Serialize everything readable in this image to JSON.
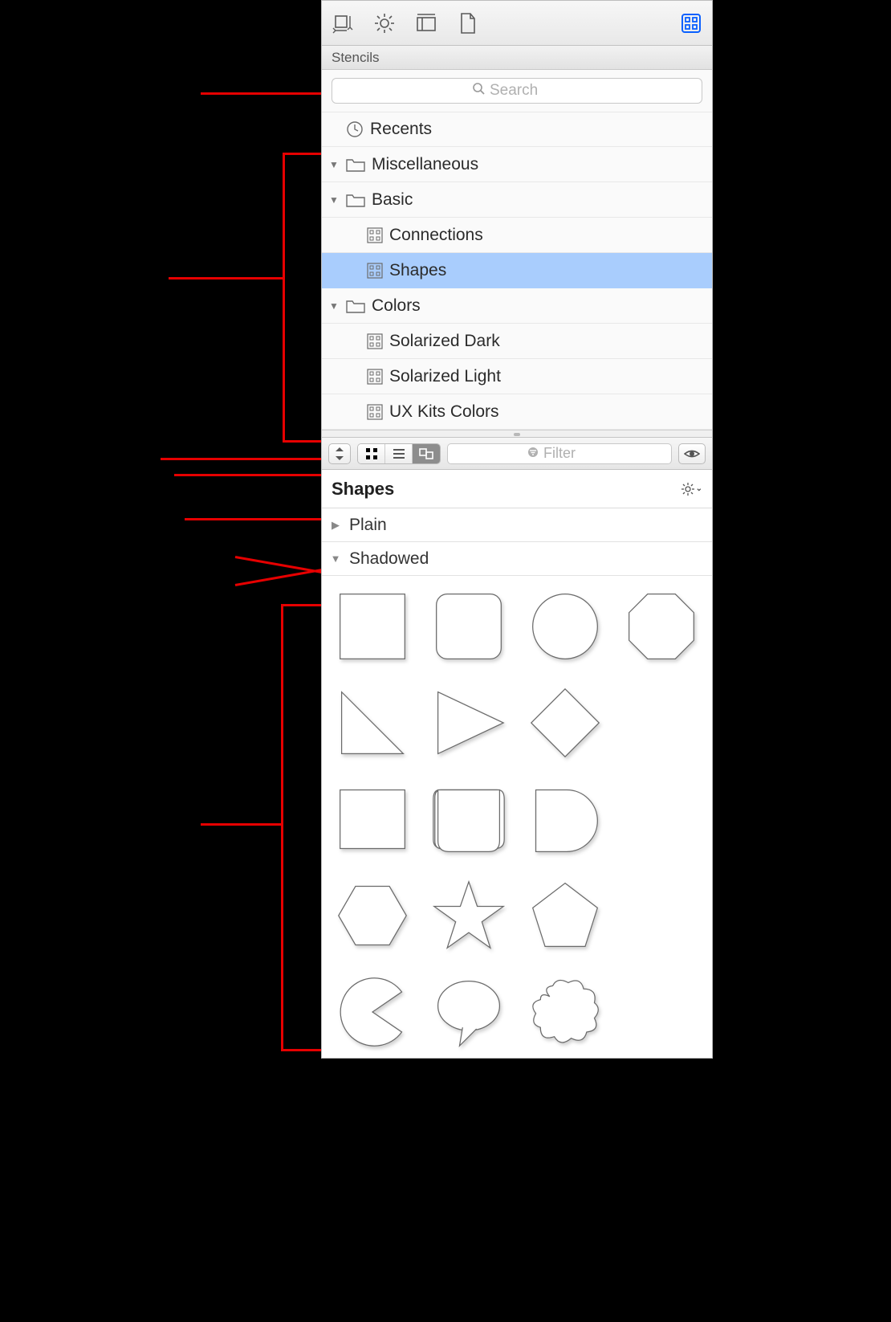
{
  "library_title": "Stencils",
  "search": {
    "placeholder": "Search"
  },
  "tree": {
    "recents_label": "Recents",
    "folders": [
      {
        "label": "Miscellaneous",
        "expanded": true,
        "items": []
      },
      {
        "label": "Basic",
        "expanded": true,
        "items": [
          {
            "label": "Connections",
            "selected": false
          },
          {
            "label": "Shapes",
            "selected": true
          }
        ]
      },
      {
        "label": "Colors",
        "expanded": true,
        "items": [
          {
            "label": "Solarized Dark",
            "selected": false
          },
          {
            "label": "Solarized Light",
            "selected": false
          },
          {
            "label": "UX Kits Colors",
            "selected": false
          }
        ]
      }
    ]
  },
  "mid_toolbar": {
    "filter_placeholder": "Filter",
    "view_mode": "canvas"
  },
  "content": {
    "title": "Shapes",
    "groups": [
      {
        "label": "Plain",
        "expanded": false
      },
      {
        "label": "Shadowed",
        "expanded": true
      }
    ],
    "shapes": [
      "square",
      "rounded-square",
      "circle",
      "octagon",
      "right-triangle",
      "triangle",
      "diamond",
      "",
      "rectangle",
      "rounded-tab",
      "half-round",
      "",
      "hexagon",
      "star",
      "pentagon",
      "",
      "pacman",
      "speech-bubble",
      "cloud",
      ""
    ]
  },
  "icons": {
    "toolbar": [
      "connections-icon",
      "gear-icon",
      "layout-icon",
      "document-icon",
      "grid-icon"
    ]
  }
}
